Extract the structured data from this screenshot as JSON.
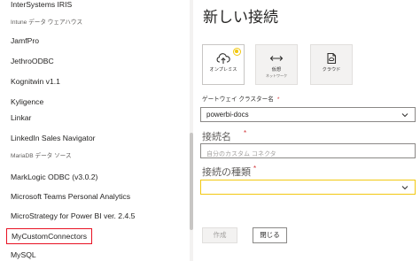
{
  "connectors": [
    {
      "label": "InterSystems IRIS",
      "small": false
    },
    {
      "label": "Intune データ ウェアハウス",
      "small": true
    },
    {
      "label": "JamfPro",
      "small": false
    },
    {
      "label": "JethroODBC",
      "small": false
    },
    {
      "label": "Kognitwin v1.1",
      "small": false
    },
    {
      "label": "Kyligence",
      "small": false
    },
    {
      "label": "Linkar",
      "small": false
    },
    {
      "label": "LinkedIn Sales Navigator",
      "small": false
    },
    {
      "label": "MariaDB データ ソース",
      "small": true
    },
    {
      "label": "MarkLogic ODBC (v3.0.2)",
      "small": false
    },
    {
      "label": "Microsoft Teams Personal Analytics",
      "small": false
    },
    {
      "label": "MicroStrategy for Power BI ver. 2.4.5",
      "small": false
    },
    {
      "label": "MyCustomConnectors",
      "small": false,
      "selected": true
    },
    {
      "label": "MySQL",
      "small": false
    }
  ],
  "dialog": {
    "title": "新しい接続",
    "tiles": [
      {
        "label": "オンプレミス",
        "sub": "",
        "icon": "cloud-upload-icon",
        "selected": true
      },
      {
        "label": "仮想",
        "sub": "ネットワーク",
        "icon": "virtual-network-icon",
        "selected": false
      },
      {
        "label": "クラウド",
        "sub": "",
        "icon": "cloud-document-icon",
        "selected": false
      }
    ],
    "gateway_label": "ゲートウェイ クラスター名",
    "required_mark": "*",
    "gateway_value": "powerbi-docs",
    "connection_name_label": "接続名",
    "connection_name_placeholder": "自分のカスタム コネクタ",
    "connection_type_label": "接続の種類",
    "connection_type_value": "",
    "create_label": "作成",
    "close_label": "閉じる"
  },
  "colors": {
    "accent": "#f2c811",
    "highlight_border": "#e81123",
    "required": "#d13438"
  }
}
